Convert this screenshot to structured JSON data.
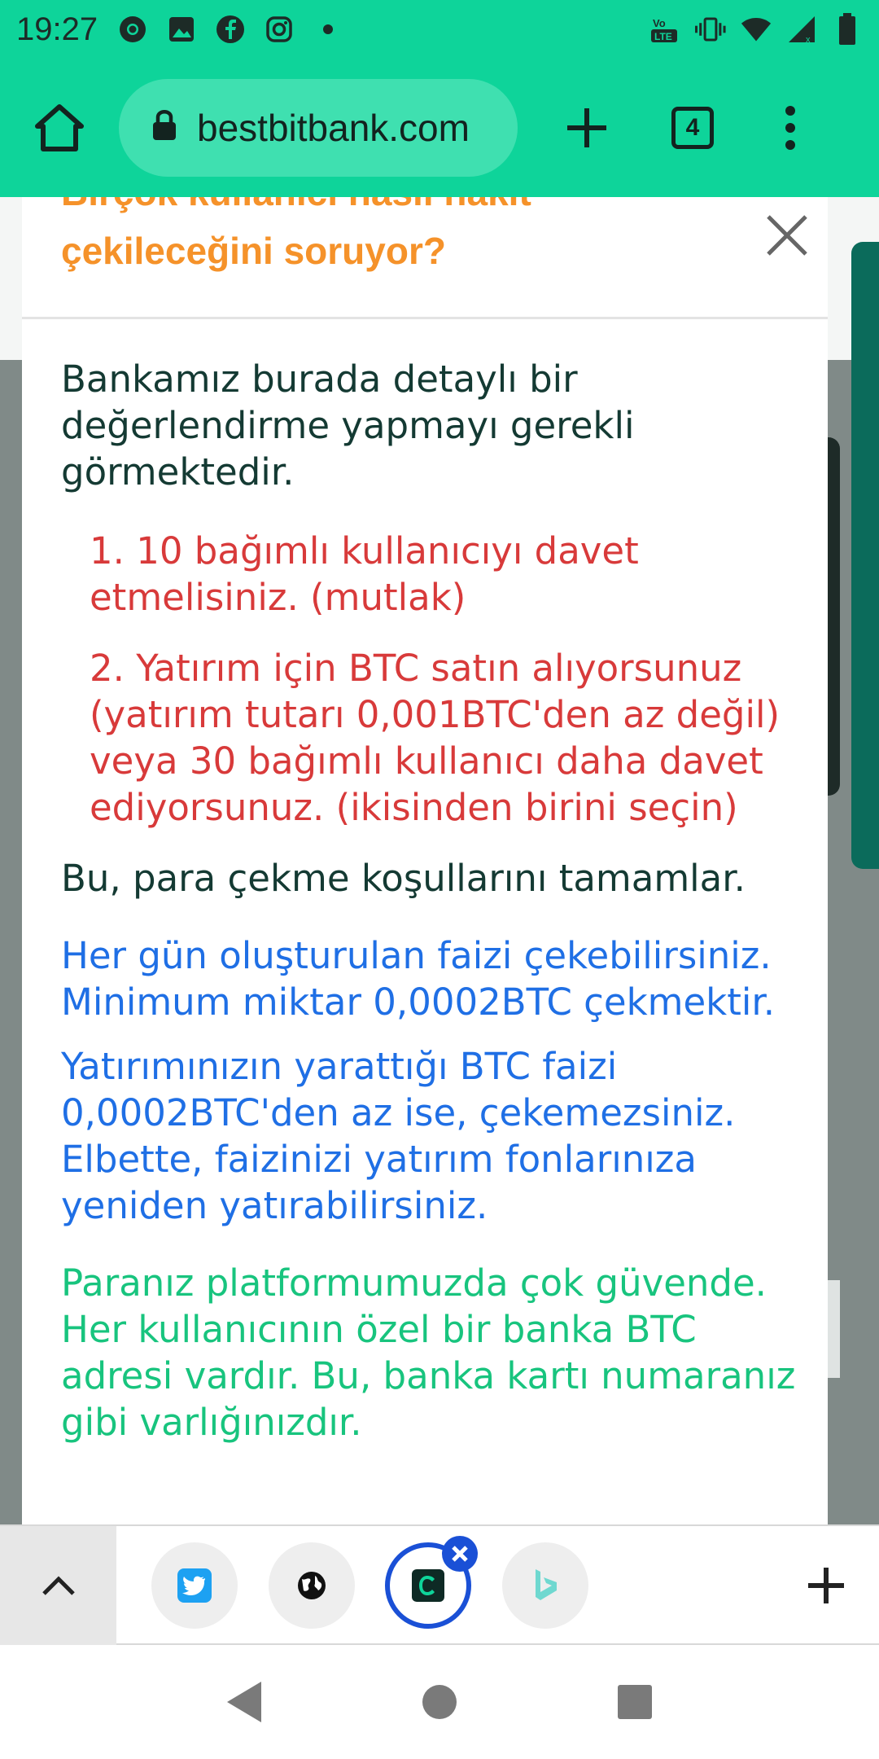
{
  "status_bar": {
    "time": "19:27",
    "left_icons": [
      "chrome-icon",
      "image-icon",
      "facebook-icon",
      "instagram-icon",
      "dot-icon"
    ],
    "right_icons": [
      "volte-icon",
      "vibrate-icon",
      "wifi-icon",
      "signal-icon",
      "battery-icon"
    ]
  },
  "toolbar": {
    "url": "bestbitbank.com",
    "tab_count": "4"
  },
  "modal": {
    "title": "Birçok kullanıcı nasıl nakit çekileceğini soruyor?",
    "intro": "Bankamız burada detaylı bir değerlendirme yapmayı gerekli görmektedir.",
    "rules": [
      "1. 10 bağımlı kullanıcıyı davet etmelisiniz. (mutlak)",
      "2. Yatırım için BTC satın alıyorsunuz (yatırım tutarı 0,001BTC'den az değil) veya 30 bağımlı kullanıcı daha davet ediyorsunuz. (ikisinden birini seçin)"
    ],
    "conclusion": "Bu, para çekme koşullarını tamamlar.",
    "blue_para_1": "Her gün oluşturulan faizi çekebilirsiniz. Minimum miktar 0,0002BTC çekmektir.",
    "blue_para_2": "Yatırımınızın yarattığı BTC faizi 0,0002BTC'den az ise, çekemezsiniz. Elbette, faizinizi yatırım fonlarınıza yeniden yatırabilirsiniz.",
    "green_para": "Paranız platformumuzda çok güvende. Her kullanıcının özel bir banka BTC adresi vardır. Bu, banka kartı numaranız gibi varlığınızdır."
  },
  "colors": {
    "brand": "#0ed49a",
    "title_orange": "#f5922a",
    "red_text": "#d83a3a",
    "blue_text": "#1f6fe5",
    "green_text": "#18c47e",
    "active_tab": "#1a50d6"
  },
  "tab_strip": {
    "tabs": [
      "twitter-icon",
      "globe-icon",
      "c-app-icon",
      "bing-icon"
    ],
    "active_index": 2
  }
}
